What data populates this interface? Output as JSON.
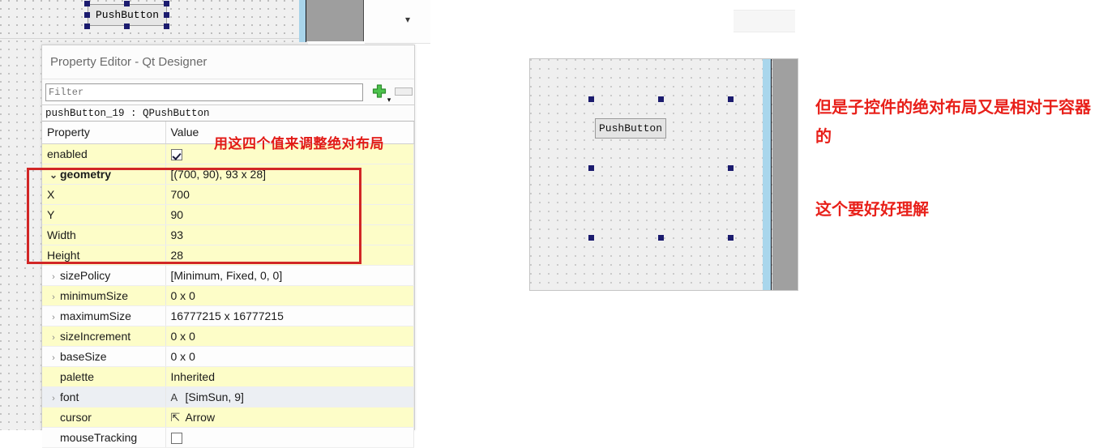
{
  "canvas": {
    "top_pushbutton_label": "PushButton",
    "chevron_icon": "chevron-down-icon"
  },
  "property_editor": {
    "title": "Property Editor - Qt Designer",
    "filter": {
      "value": "",
      "placeholder": "Filter"
    },
    "add_button_icon": "plus-icon",
    "add_button_caret": "▾",
    "remove_button_icon": "minus-icon",
    "object_row": "pushButton_19 : QPushButton",
    "columns": {
      "property": "Property",
      "value": "Value"
    },
    "rows": [
      {
        "name": "enabled",
        "value": "",
        "expander": "none",
        "indent": 1,
        "bold": false,
        "tint": "yellow",
        "widget": "checkbox-checked"
      },
      {
        "name": "geometry",
        "value": "[(700, 90), 93 x 28]",
        "expander": "open",
        "indent": 0,
        "bold": true,
        "tint": "yellow",
        "widget": "none"
      },
      {
        "name": "X",
        "value": "700",
        "expander": "none",
        "indent": 1,
        "bold": false,
        "tint": "yellow",
        "widget": "none"
      },
      {
        "name": "Y",
        "value": "90",
        "expander": "none",
        "indent": 1,
        "bold": false,
        "tint": "yellow",
        "widget": "none"
      },
      {
        "name": "Width",
        "value": "93",
        "expander": "none",
        "indent": 1,
        "bold": false,
        "tint": "yellow",
        "widget": "none"
      },
      {
        "name": "Height",
        "value": "28",
        "expander": "none",
        "indent": 1,
        "bold": false,
        "tint": "yellow",
        "widget": "none"
      },
      {
        "name": "sizePolicy",
        "value": "[Minimum, Fixed, 0, 0]",
        "expander": "closed",
        "indent": 0,
        "bold": false,
        "tint": "white",
        "widget": "none"
      },
      {
        "name": "minimumSize",
        "value": "0 x 0",
        "expander": "closed",
        "indent": 0,
        "bold": false,
        "tint": "yellow",
        "widget": "none"
      },
      {
        "name": "maximumSize",
        "value": "16777215 x 16777215",
        "expander": "closed",
        "indent": 0,
        "bold": false,
        "tint": "white",
        "widget": "none"
      },
      {
        "name": "sizeIncrement",
        "value": "0 x 0",
        "expander": "closed",
        "indent": 0,
        "bold": false,
        "tint": "yellow",
        "widget": "none"
      },
      {
        "name": "baseSize",
        "value": "0 x 0",
        "expander": "closed",
        "indent": 0,
        "bold": false,
        "tint": "white",
        "widget": "none"
      },
      {
        "name": "palette",
        "value": "Inherited",
        "expander": "none",
        "indent": 0,
        "bold": false,
        "tint": "yellow",
        "widget": "none"
      },
      {
        "name": "font",
        "value": "[SimSun, 9]",
        "expander": "closed",
        "indent": 0,
        "bold": false,
        "tint": "gray",
        "widget": "font-icon"
      },
      {
        "name": "cursor",
        "value": "Arrow",
        "expander": "none",
        "indent": 0,
        "bold": false,
        "tint": "yellow",
        "widget": "cursor-icon"
      },
      {
        "name": "mouseTracking",
        "value": "",
        "expander": "none",
        "indent": 0,
        "bold": false,
        "tint": "white",
        "widget": "checkbox-unchecked"
      }
    ]
  },
  "annotations": {
    "panel_note": "用这四个值来调整绝对布局",
    "right_note_1": "但是子控件的绝对布局又是相对于容器的",
    "right_note_2": "这个要好好理解",
    "color": "#e8201a",
    "highlight_box_color": "#d12626"
  },
  "preview": {
    "pushbutton_label": "PushButton",
    "selection_handles": 8
  }
}
